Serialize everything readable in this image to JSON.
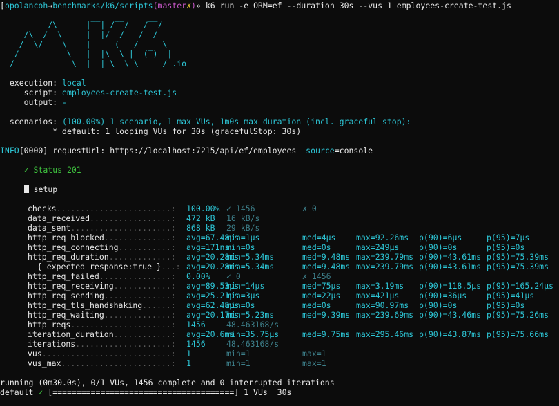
{
  "prompt": {
    "prefix": "[",
    "user": "opolancoh",
    "arrow": "→",
    "path": "benchmarks/k6/scripts",
    "branch_open": "(",
    "branch": "master",
    "dirty": "✗",
    "branch_close": ")",
    "end": "»",
    "command": "k6 run -e ORM=ef --duration 30s --vus 1 employees-create-test.js"
  },
  "logo": {
    "lines": [
      "          /\\      |‾‾| /‾‾/   /‾‾/",
      "     /\\  /  \\     |  |/  /   /  /",
      "    /  \\/    \\    |     (   /   ‾‾\\",
      "   /          \\   |  |\\  \\ |  (‾)  |",
      "  / __________ \\  |__| \\__\\ \\_____/ "
    ],
    "suffix": ".io"
  },
  "execution": {
    "execution_label": "execution:",
    "execution_value": "local",
    "script_label": "script:",
    "script_value": "employees-create-test.js",
    "output_label": "output:",
    "output_value": "-"
  },
  "scenarios": {
    "label": "scenarios:",
    "summary": "(100.00%) 1 scenario, 1 max VUs, 1m0s max duration (incl. graceful stop):",
    "detail": "* default: 1 looping VUs for 30s (gracefulStop: 30s)"
  },
  "log": {
    "level": "INFO",
    "code": "[0000]",
    "message": "requestUrl: https://localhost:7215/api/ef/employees",
    "source_key": "source",
    "source_eq": "=",
    "source_val": "console"
  },
  "check": {
    "mark": "✓",
    "label": "Status 201"
  },
  "group": {
    "label": "setup"
  },
  "metrics": [
    {
      "name": "checks",
      "dots": "........................:",
      "c1": "100.00%",
      "c2": "✓ 1456",
      "c3": "✗ 0"
    },
    {
      "name": "data_received",
      "dots": ".................:",
      "c1": "472 kB",
      "c2": "16 kB/s"
    },
    {
      "name": "data_sent",
      "dots": ".....................:",
      "c1": "868 kB",
      "c2": "29 kB/s"
    },
    {
      "name": "http_req_blocked",
      "dots": "..............:",
      "c1": "avg=67.48µs",
      "c2": "min=1µs",
      "c3": "med=4µs",
      "c4": "max=92.26ms",
      "c5": "p(90)=6µs",
      "c6": "p(95)=7µs"
    },
    {
      "name": "http_req_connecting",
      "dots": "...........:",
      "c1": "avg=171ns",
      "c2": "min=0s",
      "c3": "med=0s",
      "c4": "max=249µs",
      "c5": "p(90)=0s",
      "c6": "p(95)=0s"
    },
    {
      "name": "http_req_duration",
      "dots": ".............:",
      "c1": "avg=20.28ms",
      "c2": "min=5.34ms",
      "c3": "med=9.48ms",
      "c4": "max=239.79ms",
      "c5": "p(90)=43.61ms",
      "c6": "p(95)=75.39ms"
    },
    {
      "name": "  { expected_response:true }",
      "dots": "...:",
      "c1": "avg=20.28ms",
      "c2": "min=5.34ms",
      "c3": "med=9.48ms",
      "c4": "max=239.79ms",
      "c5": "p(90)=43.61ms",
      "c6": "p(95)=75.39ms"
    },
    {
      "name": "http_req_failed",
      "dots": "...............:",
      "c1": "0.00%",
      "c2": "✓ 0",
      "c3": "✗ 1456"
    },
    {
      "name": "http_req_receiving",
      "dots": "............:",
      "c1": "avg=89.53µs",
      "c2": "min=14µs",
      "c3": "med=75µs",
      "c4": "max=3.19ms",
      "c5": "p(90)=118.5µs",
      "c6": "p(95)=165.24µs"
    },
    {
      "name": "http_req_sending",
      "dots": "..............:",
      "c1": "avg=25.21µs",
      "c2": "min=3µs",
      "c3": "med=22µs",
      "c4": "max=421µs",
      "c5": "p(90)=36µs",
      "c6": "p(95)=41µs"
    },
    {
      "name": "http_req_tls_handshaking",
      "dots": "......:",
      "c1": "avg=62.48µs",
      "c2": "min=0s",
      "c3": "med=0s",
      "c4": "max=90.97ms",
      "c5": "p(90)=0s",
      "c6": "p(95)=0s"
    },
    {
      "name": "http_req_waiting",
      "dots": "..............:",
      "c1": "avg=20.17ms",
      "c2": "min=5.23ms",
      "c3": "med=9.39ms",
      "c4": "max=239.69ms",
      "c5": "p(90)=43.46ms",
      "c6": "p(95)=75.26ms"
    },
    {
      "name": "http_reqs",
      "dots": ".....................:",
      "c1": "1456",
      "c2": "48.463168/s"
    },
    {
      "name": "iteration_duration",
      "dots": "............:",
      "c1": "avg=20.6ms",
      "c2": "min=35.75µs",
      "c3": "med=9.75ms",
      "c4": "max=295.46ms",
      "c5": "p(90)=43.87ms",
      "c6": "p(95)=75.66ms"
    },
    {
      "name": "iterations",
      "dots": "....................:",
      "c1": "1456",
      "c2": "48.463168/s"
    },
    {
      "name": "vus",
      "dots": "...........................:",
      "c1": "1",
      "c2": "min=1",
      "c3": "max=1"
    },
    {
      "name": "vus_max",
      "dots": ".......................:",
      "c1": "1",
      "c2": "min=1",
      "c3": "max=1"
    }
  ],
  "footer": {
    "running": "running (0m30.0s), 0/1 VUs, 1456 complete and 0 interrupted iterations",
    "scenario": "default",
    "check": "✓",
    "bar": "[======================================]",
    "vus": "1 VUs",
    "time": "30s"
  }
}
